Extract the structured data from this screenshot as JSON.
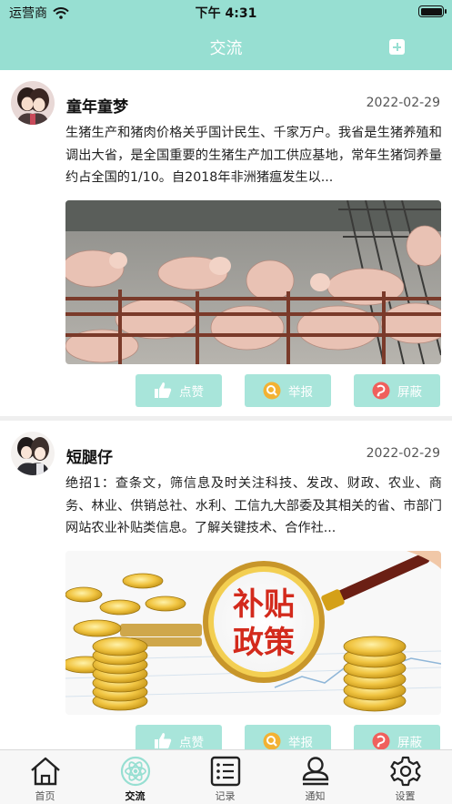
{
  "status_bar": {
    "carrier": "运营商",
    "time": "下午 4:31"
  },
  "header": {
    "title": "交流",
    "add_icon": "plus-square-icon"
  },
  "colors": {
    "accent": "#97dfd2",
    "button": "#a8e5da",
    "report_icon": "#f2b233",
    "block_icon": "#f0605c"
  },
  "posts": [
    {
      "author": "童年童梦",
      "date": "2022-02-29",
      "content": "  生猪生产和猪肉价格关乎国计民生、千家万户。我省是生猪养殖和调出大省，是全国重要的生猪生产加工供应基地，常年生猪饲养量约占全国的1/10。自2018年非洲猪瘟发生以...",
      "image": "pigs-in-pen-photo",
      "actions": {
        "like": "点赞",
        "report": "举报",
        "block": "屏蔽"
      }
    },
    {
      "author": "短腿仔",
      "date": "2022-02-29",
      "content": "绝招1：查条文，筛信息及时关注科技、发改、财政、农业、商务、林业、供销总社、水利、工信九大部委及其相关的省、市部门网站农业补贴类信息。了解关键技术、合作社...",
      "image": "subsidy-policy-magnifier-photo",
      "image_text": [
        "补贴",
        "政策"
      ],
      "actions": {
        "like": "点赞",
        "report": "举报",
        "block": "屏蔽"
      }
    }
  ],
  "tabbar": [
    {
      "label": "首页",
      "icon": "home-icon",
      "active": false
    },
    {
      "label": "交流",
      "icon": "atom-icon",
      "active": true
    },
    {
      "label": "记录",
      "icon": "list-icon",
      "active": false
    },
    {
      "label": "通知",
      "icon": "person-icon",
      "active": false
    },
    {
      "label": "设置",
      "icon": "gear-icon",
      "active": false
    }
  ]
}
